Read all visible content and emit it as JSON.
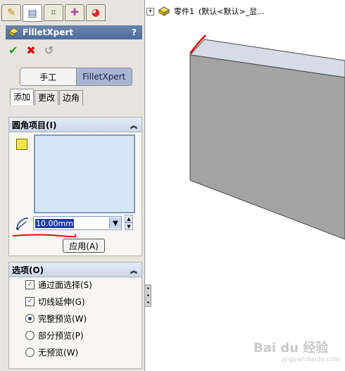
{
  "property_tabs": [
    "feature-manager",
    "property-manager",
    "configuration-manager",
    "dimxpert-manager",
    "display-manager"
  ],
  "panel_title": "FilletXpert",
  "help_symbol": "?",
  "mode_buttons": {
    "manual": "手工",
    "filletxpert": "FilletXpert"
  },
  "sub_tabs": [
    "添加",
    "更改",
    "边角"
  ],
  "fillet_items": {
    "header": "圆角项目(I)",
    "radius_value": "10.00mm",
    "apply_label": "应用(A)"
  },
  "options": {
    "header": "选项(O)",
    "items": [
      {
        "type": "checkbox",
        "label": "通过面选择(S)",
        "checked": true
      },
      {
        "type": "checkbox",
        "label": "切线延伸(G)",
        "checked": true
      },
      {
        "type": "radio",
        "label": "完整预览(W)",
        "checked": true
      },
      {
        "type": "radio",
        "label": "部分预览(P)",
        "checked": false
      },
      {
        "type": "radio",
        "label": "无预览(W)",
        "checked": false
      }
    ]
  },
  "tree": {
    "part_label": "零件1",
    "config_label": "(默认<默认>_显..."
  },
  "watermark": {
    "text": "Bai du 经验",
    "sub": "jingyan.baidu.com"
  },
  "colors": {
    "title_bar": "#4d6a99",
    "selection_box": "#d5e6f7",
    "red_annotation": "#e01010",
    "model_top": "#d6dbe8",
    "model_front": "#a4a4a4"
  }
}
